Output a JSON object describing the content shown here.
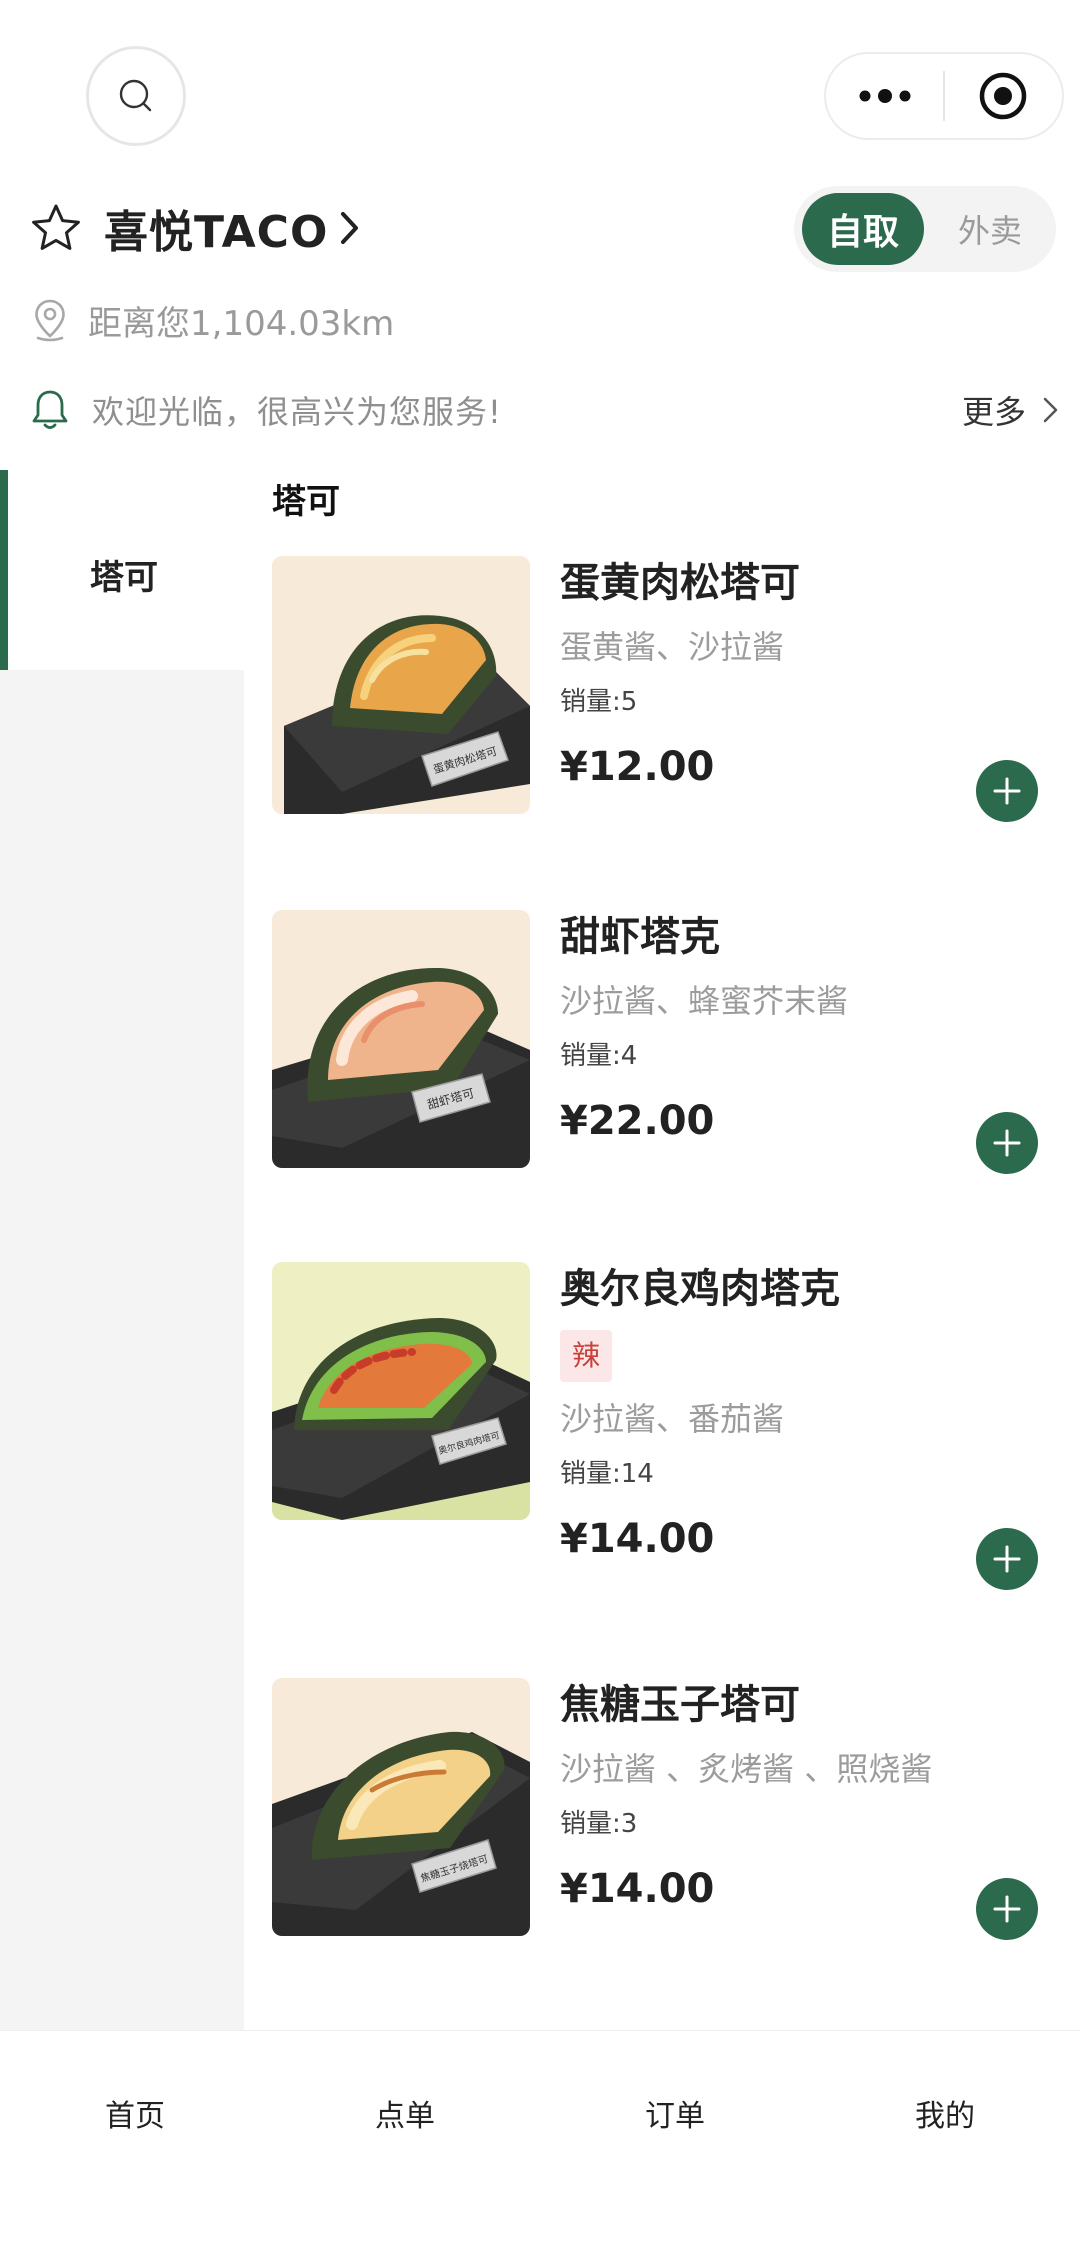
{
  "header": {
    "store_name": "喜悦TACO",
    "mode_selected": "自取",
    "mode_other": "外卖",
    "distance": "距离您1,104.03km",
    "notice": "欢迎光临，很高兴为您服务!",
    "more_label": "更多",
    "icons": [
      "search-icon",
      "more-dots-icon",
      "target-icon",
      "star-icon",
      "location-pin-icon",
      "bell-icon",
      "chevron-right-icon"
    ]
  },
  "sidebar": {
    "items": [
      {
        "label": "塔可",
        "active": true
      }
    ]
  },
  "main": {
    "section_title": "塔可",
    "products": [
      {
        "name": "蛋黄肉松塔可",
        "tag": "",
        "desc": "蛋黄酱、沙拉酱",
        "sales": "销量:5",
        "price": "¥12.00",
        "sign": "蛋黄肉松塔可"
      },
      {
        "name": "甜虾塔克",
        "tag": "",
        "desc": "沙拉酱、蜂蜜芥末酱",
        "sales": "销量:4",
        "price": "¥22.00",
        "sign": "甜虾塔可"
      },
      {
        "name": "奥尔良鸡肉塔克",
        "tag": "辣",
        "desc": "沙拉酱、番茄酱",
        "sales": "销量:14",
        "price": "¥14.00",
        "sign": "奥尔良鸡肉塔可"
      },
      {
        "name": "焦糖玉子塔可",
        "tag": "",
        "desc": "沙拉酱 、炙烤酱 、照烧酱",
        "sales": "销量:3",
        "price": "¥14.00",
        "sign": "焦糖玉子烧塔可"
      }
    ]
  },
  "tabbar": {
    "items": [
      {
        "label": "首页"
      },
      {
        "label": "点单"
      },
      {
        "label": "订单"
      },
      {
        "label": "我的"
      }
    ]
  },
  "colors": {
    "accent": "#2b6a4c",
    "spicy_tag_bg": "#fbe7e7",
    "spicy_tag_text": "#c9403c",
    "muted_text": "#9a9a9a"
  }
}
